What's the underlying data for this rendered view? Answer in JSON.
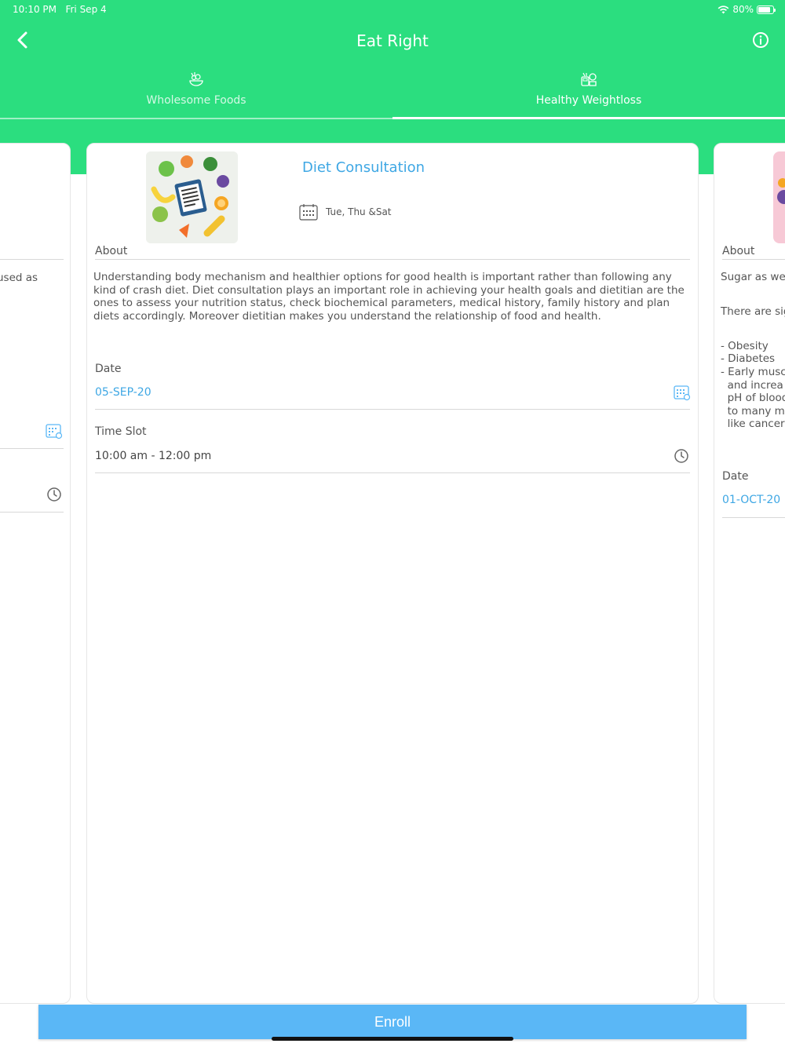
{
  "status": {
    "time": "10:10 PM",
    "date": "Fri Sep 4",
    "battery": "80%"
  },
  "header": {
    "title": "Eat Right"
  },
  "tabs": [
    {
      "label": "Wholesome Foods",
      "active": false
    },
    {
      "label": "Healthy Weightloss",
      "active": true
    }
  ],
  "main_card": {
    "title": "Diet Consultation",
    "schedule": "Tue, Thu &Sat",
    "about_label": "About",
    "about_text": "Understanding body mechanism and healthier options for good health is important rather than following any kind of crash diet. Diet consultation plays an important role in achieving your health goals and dietitian are the ones to assess your nutrition status, check biochemical parameters, medical history, family history and plan diets accordingly. Moreover dietitian makes you understand the relationship of food and health.",
    "date_label": "Date",
    "date_value": "05-SEP-20",
    "timeslot_label": "Time Slot",
    "timeslot_value": "10:00 am - 12:00 pm"
  },
  "left_card": {
    "about_fragment": "used as"
  },
  "right_card": {
    "about_label": "About",
    "line1": "Sugar as we",
    "line2": "There are sig",
    "bullets": [
      "- Obesity",
      "- Diabetes",
      "- Early muscl",
      "  and increa",
      "  pH of blood",
      "  to many m",
      "  like cancer"
    ],
    "date_label": "Date",
    "date_value": "01-OCT-20"
  },
  "footer": {
    "enroll_label": "Enroll"
  },
  "colors": {
    "primary_green": "#2bde7f",
    "accent_blue": "#3ea7e4",
    "button_blue": "#5ab7f6"
  }
}
